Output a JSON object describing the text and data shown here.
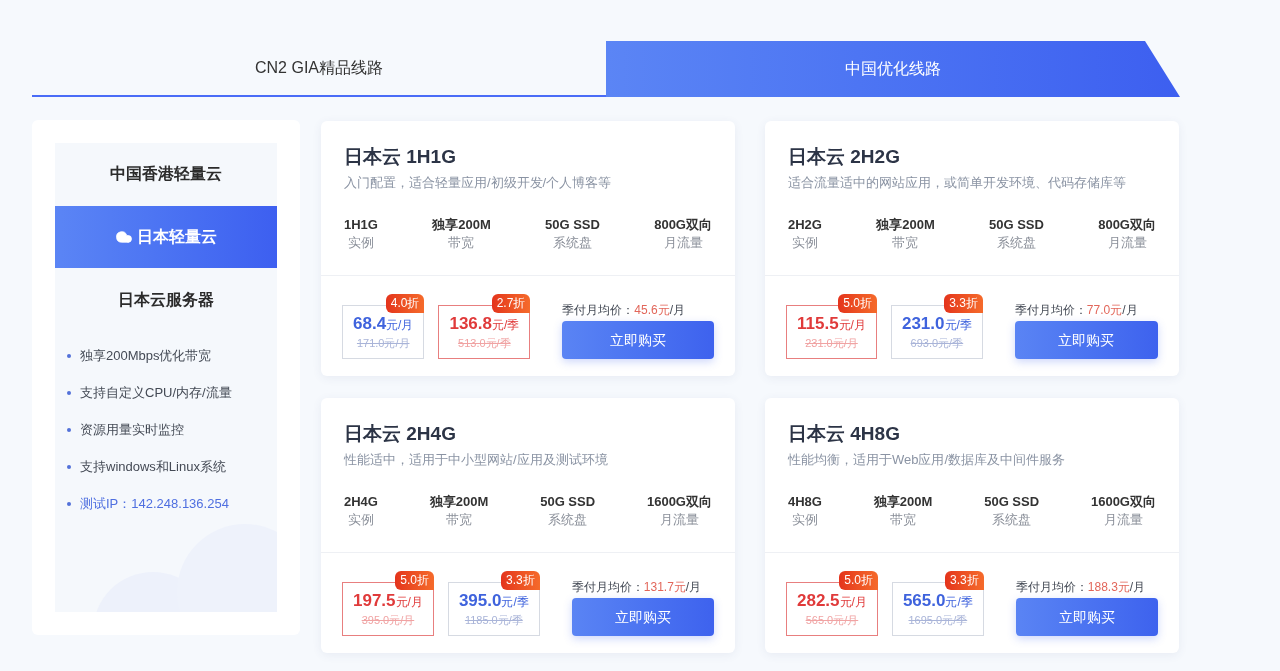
{
  "tabs": [
    {
      "label": "CN2 GIA精品线路",
      "selected": false
    },
    {
      "label": "中国优化线路",
      "selected": true
    }
  ],
  "sidebar": {
    "items": [
      {
        "label": "中国香港轻量云",
        "selected": false
      },
      {
        "label": "日本轻量云",
        "selected": true
      },
      {
        "label": "日本云服务器",
        "selected": false
      }
    ],
    "features": [
      {
        "text": "独享200Mbps优化带宽",
        "kind": "plain"
      },
      {
        "text": "支持自定义CPU/内存/流量",
        "kind": "plain"
      },
      {
        "text": "资源用量实时监控",
        "kind": "plain"
      },
      {
        "text": "支持windows和Linux系统",
        "kind": "plain"
      },
      {
        "text": "测试IP：142.248.136.254",
        "kind": "accent"
      }
    ]
  },
  "plans": [
    {
      "title": "日本云 1H1G",
      "description": "入门配置，适合轻量应用/初级开发/个人博客等",
      "specs": [
        {
          "value": "1H1G",
          "label": "实例"
        },
        {
          "value": "独享200M",
          "label": "带宽"
        },
        {
          "value": "50G SSD",
          "label": "系统盘"
        },
        {
          "value": "800G双向",
          "label": "月流量"
        }
      ],
      "prices": [
        {
          "badge": "4.0折",
          "price": "68.4",
          "unit": "元/月",
          "original": "171.0元/月",
          "selected": false
        },
        {
          "badge": "2.7折",
          "price": "136.8",
          "unit": "元/季",
          "original": "513.0元/季",
          "selected": true
        }
      ],
      "average": {
        "label": "季付月均价：",
        "value": "45.6元",
        "unit": "/月"
      },
      "button": "立即购买"
    },
    {
      "title": "日本云 2H2G",
      "description": "适合流量适中的网站应用，或简单开发环境、代码存储库等",
      "specs": [
        {
          "value": "2H2G",
          "label": "实例"
        },
        {
          "value": "独享200M",
          "label": "带宽"
        },
        {
          "value": "50G SSD",
          "label": "系统盘"
        },
        {
          "value": "800G双向",
          "label": "月流量"
        }
      ],
      "prices": [
        {
          "badge": "5.0折",
          "price": "115.5",
          "unit": "元/月",
          "original": "231.0元/月",
          "selected": true
        },
        {
          "badge": "3.3折",
          "price": "231.0",
          "unit": "元/季",
          "original": "693.0元/季",
          "selected": false
        }
      ],
      "average": {
        "label": "季付月均价：",
        "value": "77.0元",
        "unit": "/月"
      },
      "button": "立即购买"
    },
    {
      "title": "日本云 2H4G",
      "description": "性能适中，适用于中小型网站/应用及测试环境",
      "specs": [
        {
          "value": "2H4G",
          "label": "实例"
        },
        {
          "value": "独享200M",
          "label": "带宽"
        },
        {
          "value": "50G SSD",
          "label": "系统盘"
        },
        {
          "value": "1600G双向",
          "label": "月流量"
        }
      ],
      "prices": [
        {
          "badge": "5.0折",
          "price": "197.5",
          "unit": "元/月",
          "original": "395.0元/月",
          "selected": true
        },
        {
          "badge": "3.3折",
          "price": "395.0",
          "unit": "元/季",
          "original": "1185.0元/季",
          "selected": false
        }
      ],
      "average": {
        "label": "季付月均价：",
        "value": "131.7元",
        "unit": "/月"
      },
      "button": "立即购买"
    },
    {
      "title": "日本云 4H8G",
      "description": "性能均衡，适用于Web应用/数据库及中间件服务",
      "specs": [
        {
          "value": "4H8G",
          "label": "实例"
        },
        {
          "value": "独享200M",
          "label": "带宽"
        },
        {
          "value": "50G SSD",
          "label": "系统盘"
        },
        {
          "value": "1600G双向",
          "label": "月流量"
        }
      ],
      "prices": [
        {
          "badge": "5.0折",
          "price": "282.5",
          "unit": "元/月",
          "original": "565.0元/月",
          "selected": true
        },
        {
          "badge": "3.3折",
          "price": "565.0",
          "unit": "元/季",
          "original": "1695.0元/季",
          "selected": false
        }
      ],
      "average": {
        "label": "季付月均价：",
        "value": "188.3元",
        "unit": "/月"
      },
      "button": "立即购买"
    }
  ]
}
